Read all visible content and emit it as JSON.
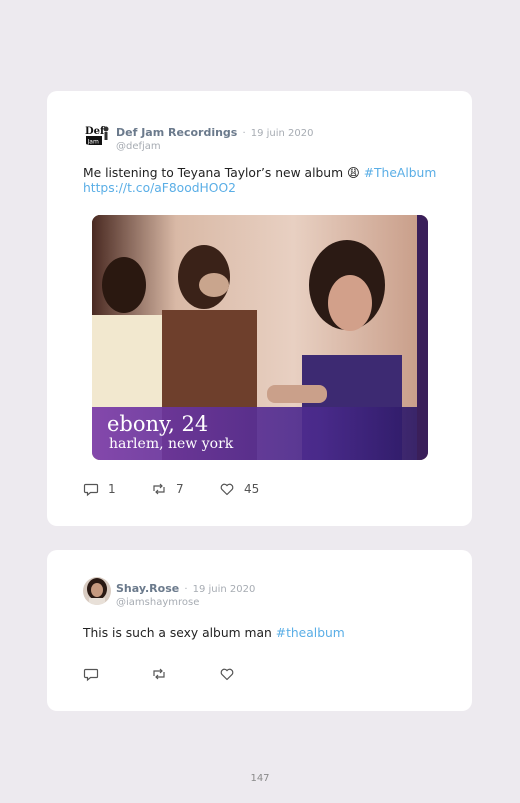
{
  "tweets": [
    {
      "author": "Def Jam Recordings",
      "date_sep": "·",
      "date": "19 juin 2020",
      "handle": "@defjam",
      "avatar_icon": "def-jam-logo",
      "text_plain": "Me listening to Teyana Taylor’s new album 😩 ",
      "hashtag": "#TheAlbum",
      "link": "https://t.co/aF8oodHOO2",
      "media": {
        "caption_name": "ebony, 24",
        "caption_place": "harlem, new york"
      },
      "actions": {
        "replies": "1",
        "retweets": "7",
        "likes": "45"
      }
    },
    {
      "author": "Shay.Rose",
      "date_sep": "·",
      "date": "19 juin 2020",
      "handle": "@iamshaymrose",
      "avatar_icon": "profile-photo",
      "text_plain": "This is such a sexy album man ",
      "hashtag": "#thealbum",
      "actions": {
        "replies": "",
        "retweets": "",
        "likes": ""
      }
    }
  ],
  "page_number": "147",
  "colors": {
    "background": "#edeaef",
    "card": "#ffffff",
    "link": "#5aaee6",
    "name": "#6b7a8c",
    "muted": "#a7acb3"
  }
}
